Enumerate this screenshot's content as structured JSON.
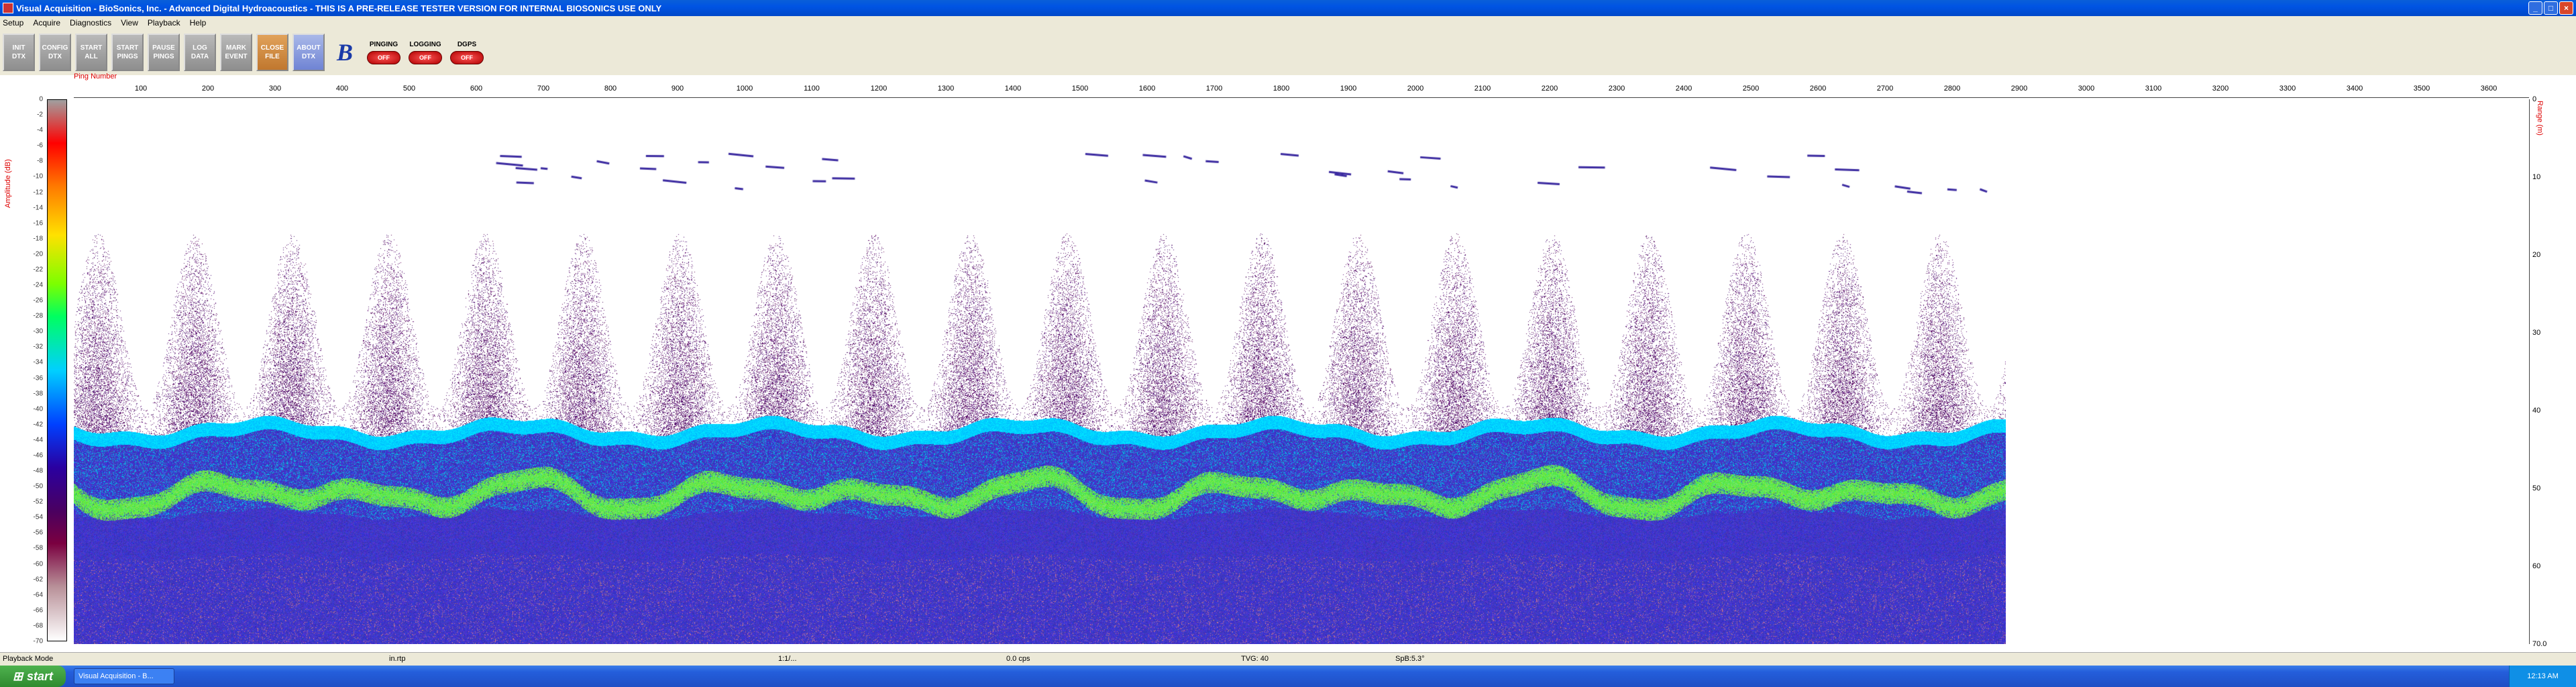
{
  "window": {
    "title": "Visual Acquisition  -  BioSonics, Inc.  -  Advanced Digital Hydroacoustics  -  THIS IS A PRE-RELEASE TESTER VERSION FOR INTERNAL BIOSONICS USE ONLY",
    "controls": [
      "_",
      "□",
      "×"
    ]
  },
  "menu": [
    "Setup",
    "Acquire",
    "Diagnostics",
    "View",
    "Playback",
    "Help"
  ],
  "toolbar": {
    "buttons": [
      {
        "label": "INIT\nDTX",
        "style": "gray"
      },
      {
        "label": "CONFIG\nDTX",
        "style": "gray"
      },
      {
        "label": "START\nALL",
        "style": "gray"
      },
      {
        "label": "START\nPINGS",
        "style": "gray"
      },
      {
        "label": "PAUSE\nPINGS",
        "style": "gray"
      },
      {
        "label": "LOG\nDATA",
        "style": "gray"
      },
      {
        "label": "MARK\nEVENT",
        "style": "gray"
      },
      {
        "label": "CLOSE\nFILE",
        "style": "orange"
      },
      {
        "label": "ABOUT\nDTX",
        "style": "blue"
      }
    ],
    "toggles": [
      {
        "label": "PINGING",
        "state": "OFF"
      },
      {
        "label": "LOGGING",
        "state": "OFF"
      },
      {
        "label": "DGPS",
        "state": "OFF"
      }
    ]
  },
  "plot": {
    "x_axis_label": "Ping Number",
    "y_left_label": "Amplitude (dB)",
    "y_right_label": "Range (m)",
    "x_ticks": [
      100,
      200,
      300,
      400,
      500,
      600,
      700,
      800,
      900,
      1000,
      1100,
      1200,
      1300,
      1400,
      1500,
      1600,
      1700,
      1800,
      1900,
      2000,
      2100,
      2200,
      2300,
      2400,
      2500,
      2600,
      2700,
      2800,
      2900,
      3000,
      3100,
      3200,
      3300,
      3400,
      3500,
      3600
    ],
    "x_range": [
      0,
      3660
    ],
    "pings_recorded": 2880,
    "depth_ticks": [
      "0",
      "10",
      "20",
      "30",
      "40",
      "50",
      "60",
      "70.0"
    ],
    "depth_range": [
      0,
      70
    ],
    "amp_ticks": [
      0,
      -2,
      -4,
      -6,
      -8,
      -10,
      -12,
      -14,
      -16,
      -18,
      -20,
      -22,
      -24,
      -26,
      -28,
      -30,
      -32,
      -34,
      -36,
      -38,
      -40,
      -42,
      -44,
      -46,
      -48,
      -50,
      -52,
      -54,
      -56,
      -58,
      -60,
      -62,
      -64,
      -66,
      -68,
      -70
    ],
    "amp_range": [
      0,
      -70
    ]
  },
  "status": [
    {
      "text": "Playback Mode"
    },
    {
      "text": "in.rtp"
    },
    {
      "text": "1:1/..."
    },
    {
      "text": "0.0 cps"
    },
    {
      "text": "TVG: 40"
    },
    {
      "text": "SpB:5.3°"
    }
  ],
  "taskbar": {
    "start_label": "start",
    "task_label": "Visual Acquisition - B...",
    "clock": "12:13 AM"
  },
  "colors": {
    "accent": "#0054e3",
    "ping_label": "#dd0000"
  }
}
